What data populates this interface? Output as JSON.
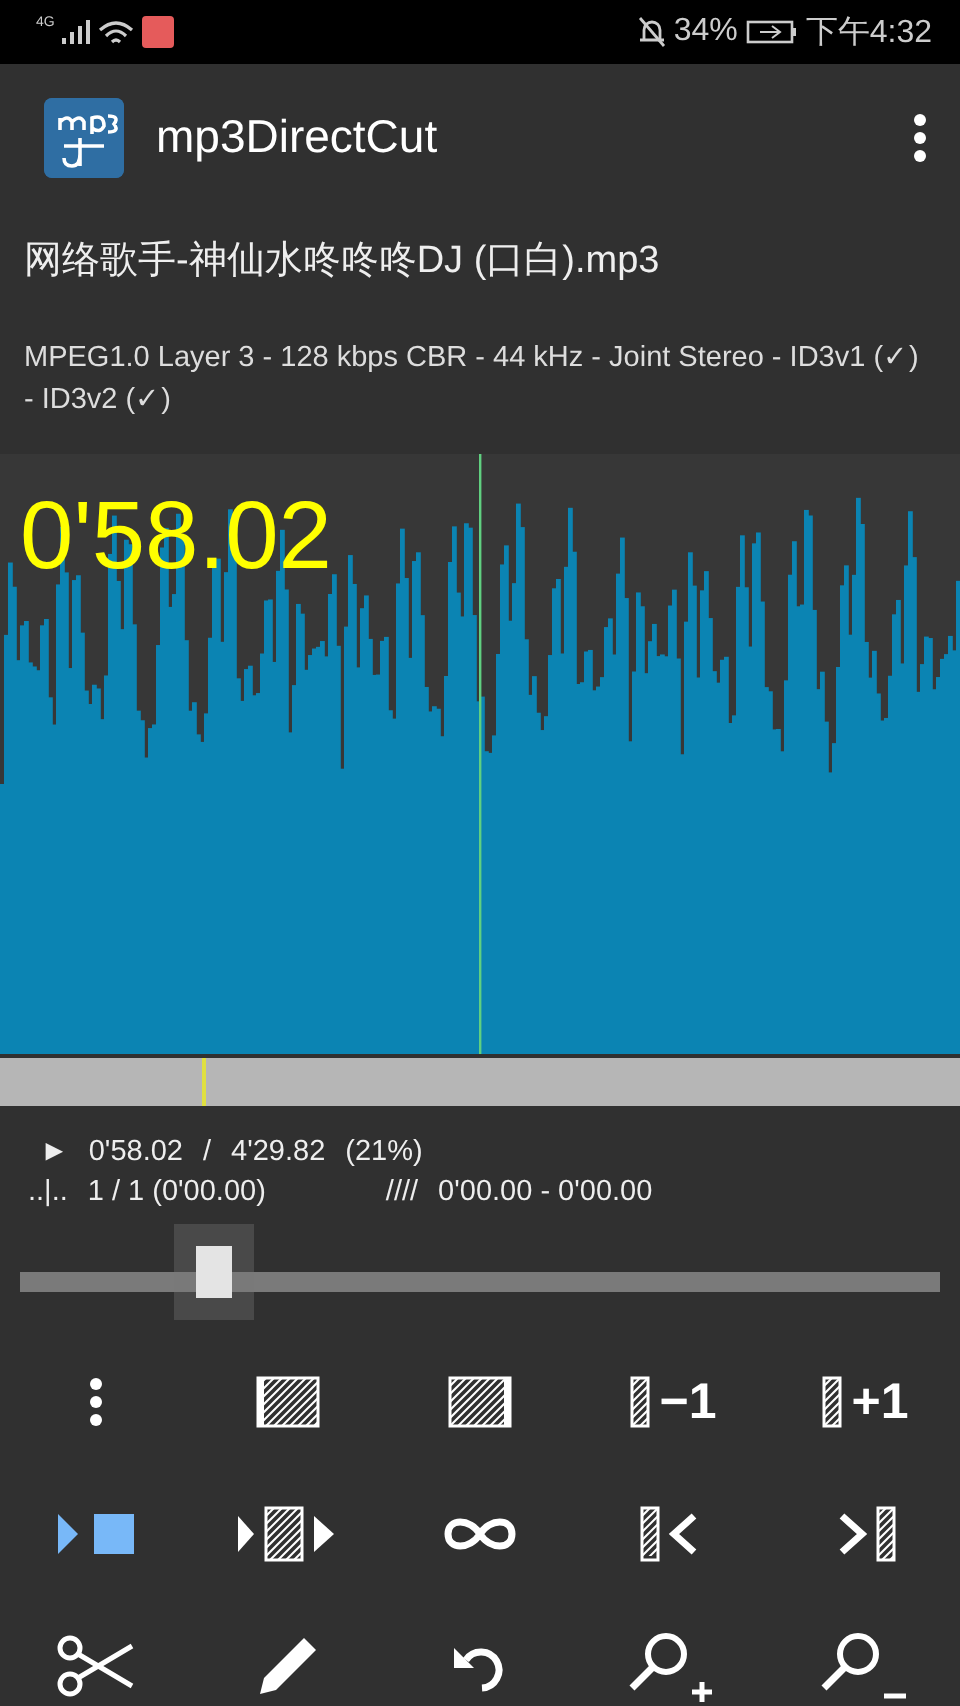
{
  "status_bar": {
    "network": "4G",
    "battery": "34%",
    "time": "下午4:32"
  },
  "app_bar": {
    "title": "mp3DirectCut"
  },
  "file": {
    "name": "网络歌手-神仙水咚咚咚DJ (口白).mp3",
    "info": "MPEG1.0 Layer 3 - 128 kbps CBR - 44 kHz - Joint Stereo - ID3v1 (✓) - ID3v2 (✓)"
  },
  "waveform": {
    "time": "0'58.02"
  },
  "position": {
    "marker": "►",
    "current": "0'58.02",
    "separator": "/",
    "total": "4'29.82",
    "percent": "(21%)"
  },
  "cue": {
    "marker": "..|..",
    "count": "1 / 1 (0'00.00)",
    "range_marker": "////",
    "range": "0'00.00 - 0'00.00"
  },
  "seek": {
    "level": 0.21
  },
  "toolbar": [
    {
      "kind": "menu",
      "active": false
    },
    {
      "kind": "select-left",
      "active": false
    },
    {
      "kind": "select-right",
      "active": false
    },
    {
      "kind": "prev",
      "label": "−1",
      "active": false
    },
    {
      "kind": "next",
      "label": "+1",
      "active": false
    },
    {
      "kind": "play",
      "active": true
    },
    {
      "kind": "play-region",
      "active": false
    },
    {
      "kind": "loop",
      "active": false
    },
    {
      "kind": "set-start",
      "active": false
    },
    {
      "kind": "set-end",
      "active": false
    },
    {
      "kind": "cut",
      "active": false
    },
    {
      "kind": "edit",
      "active": false
    },
    {
      "kind": "undo",
      "active": false
    },
    {
      "kind": "zoom-in",
      "active": false
    },
    {
      "kind": "zoom-out",
      "active": false
    }
  ]
}
